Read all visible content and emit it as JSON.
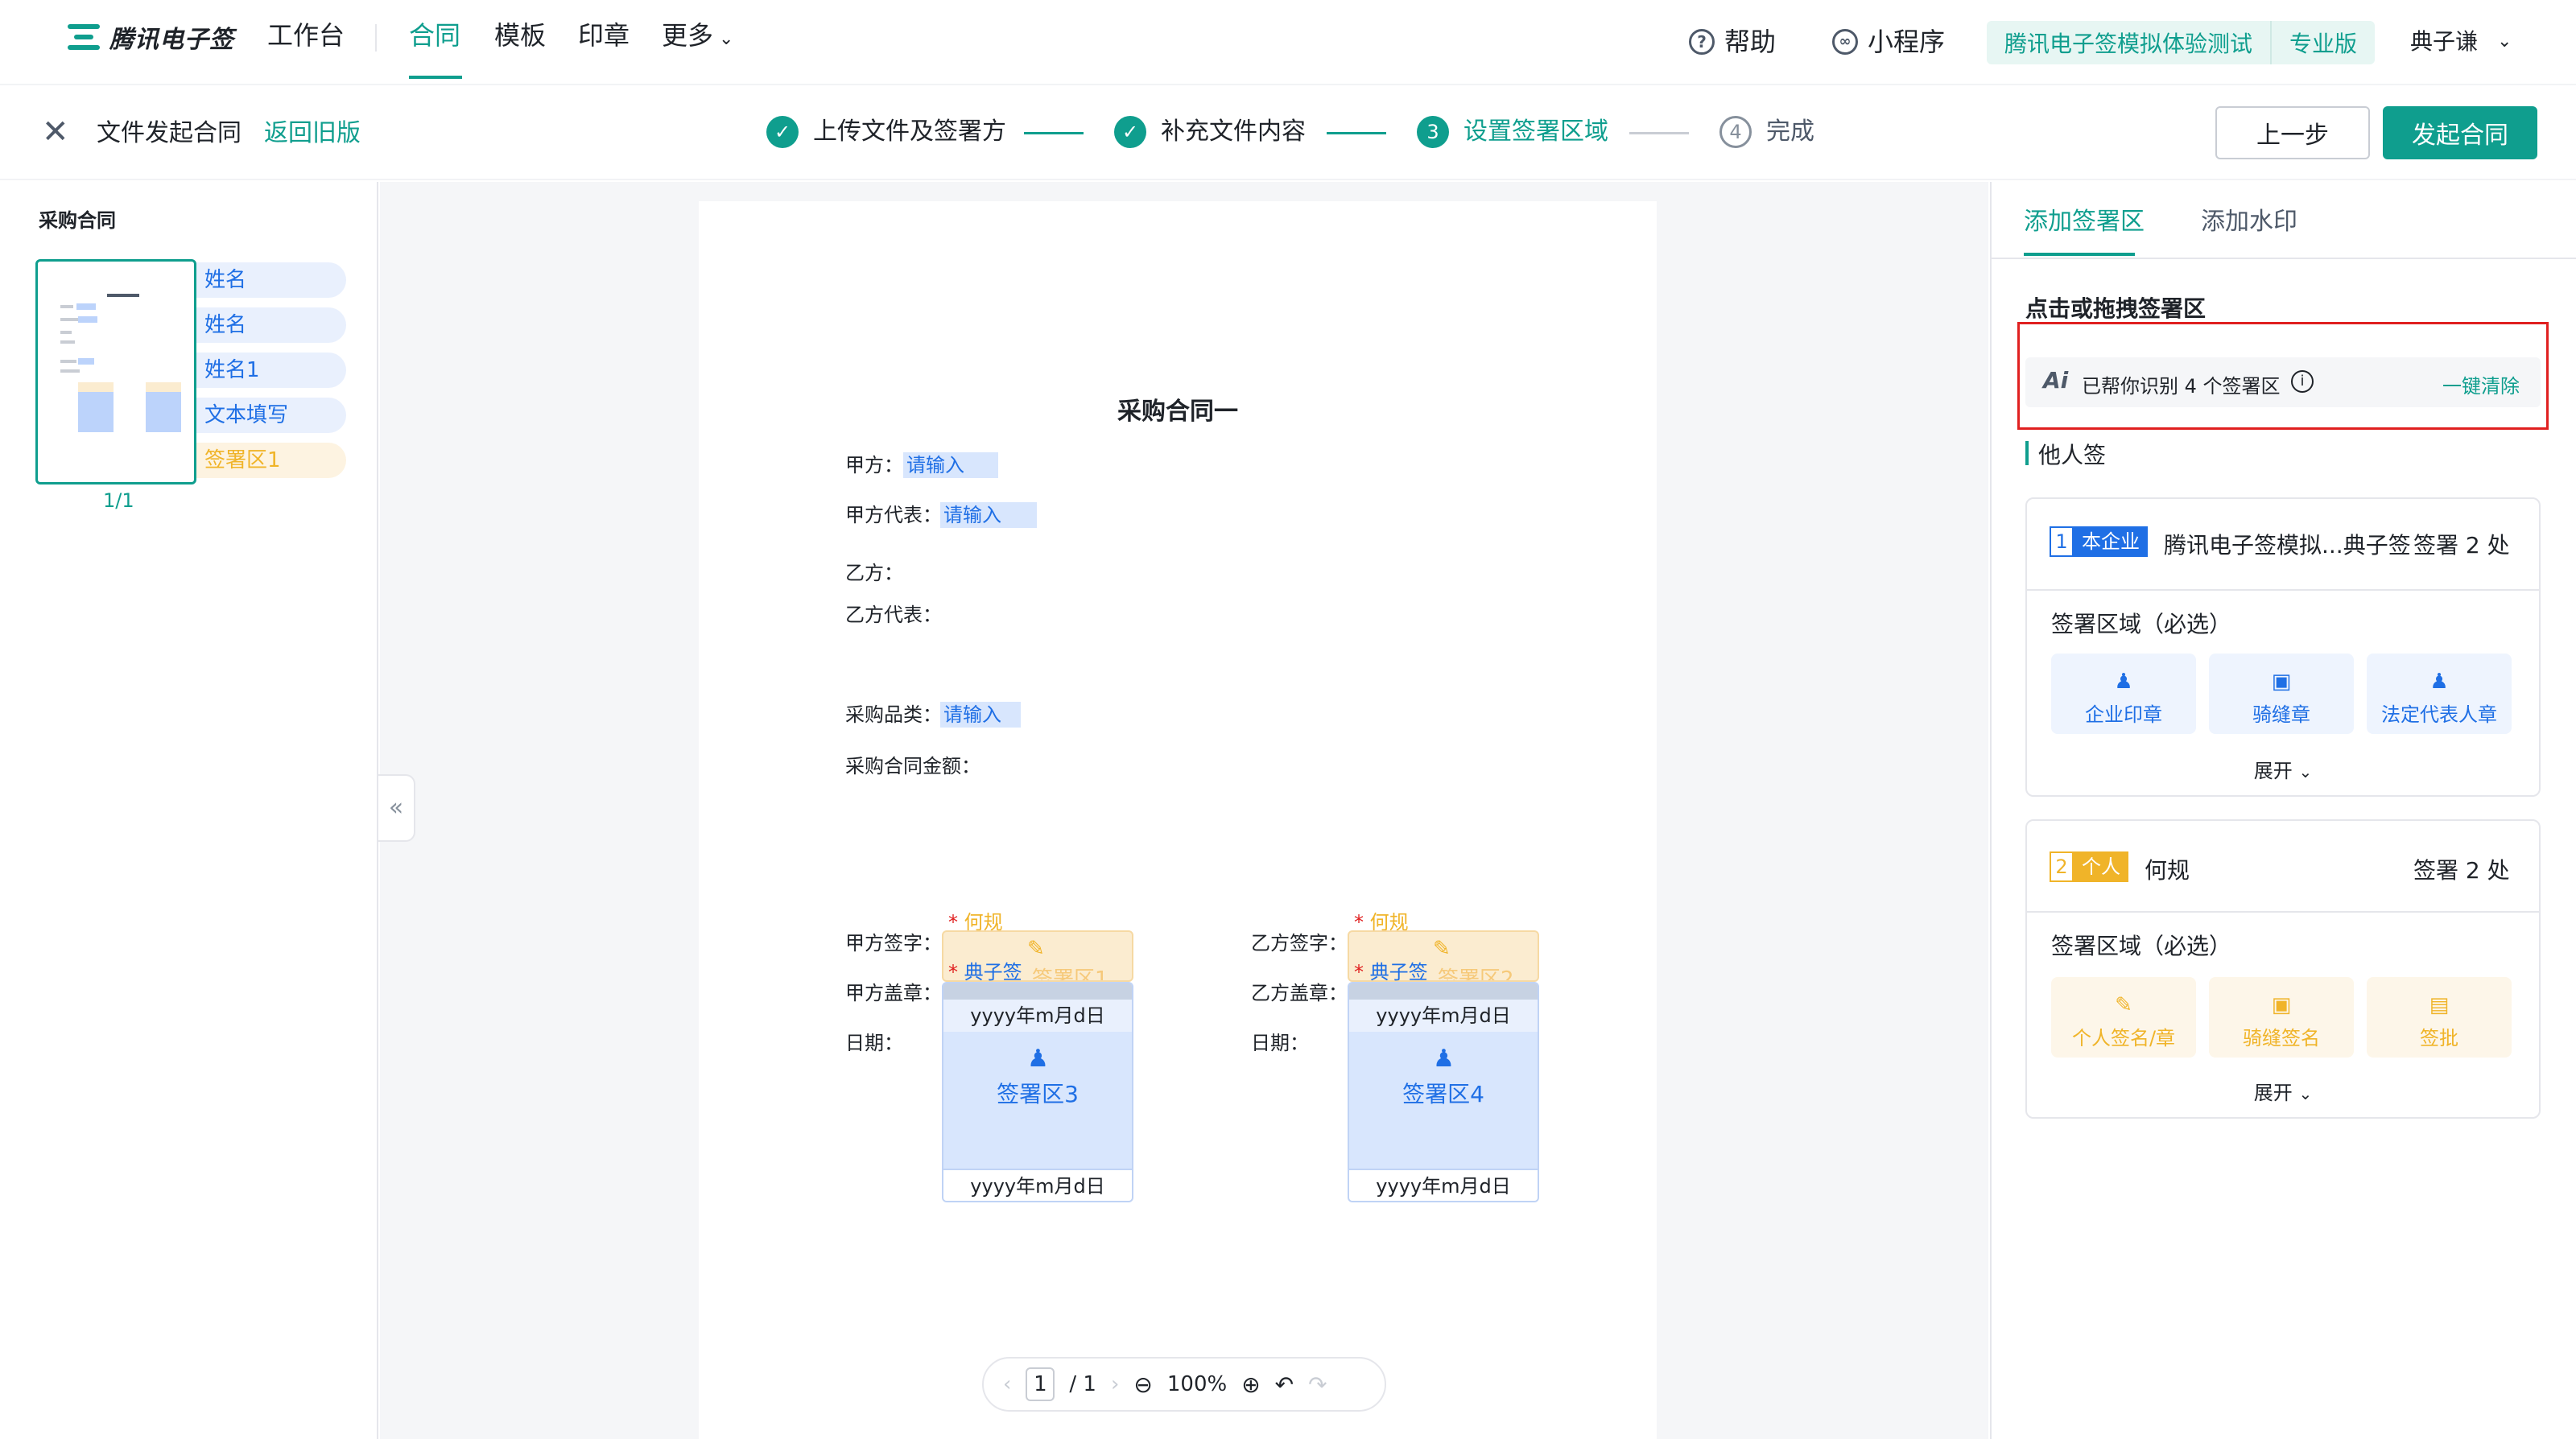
{
  "nav": {
    "logo_text": "腾讯电子签",
    "items": [
      "工作台",
      "合同",
      "模板",
      "印章",
      "更多"
    ],
    "help": "帮助",
    "mini_program": "小程序",
    "org_name": "腾讯电子签模拟体验测试",
    "edition": "专业版",
    "user": "典子谦"
  },
  "stepbar": {
    "close_label": "文件发起合同",
    "back_old": "返回旧版",
    "steps": [
      {
        "label": "上传文件及签署方",
        "state": "done"
      },
      {
        "label": "补充文件内容",
        "state": "done"
      },
      {
        "num": "3",
        "label": "设置签署区域",
        "state": "active"
      },
      {
        "num": "4",
        "label": "完成",
        "state": "todo"
      }
    ],
    "prev_button": "上一步",
    "submit_button": "发起合同"
  },
  "left": {
    "doc_title": "采购合同",
    "fields": [
      "姓名",
      "姓名",
      "姓名1",
      "文本填写",
      "签署区1"
    ],
    "page_count": "1/1"
  },
  "doc": {
    "title": "采购合同一",
    "party_a": "甲方：",
    "party_a_rep": "甲方代表：",
    "party_b": "乙方：",
    "party_b_rep": "乙方代表：",
    "category": "采购品类：",
    "amount": "采购合同金额：",
    "placeholder": "请输入",
    "a_sign": "甲方签字：",
    "a_seal": "甲方盖章：",
    "b_sign": "乙方签字：",
    "b_seal": "乙方盖章：",
    "date": "日期：",
    "signer_personal": "何规",
    "signer_company": "典子签",
    "date_format": "yyyy年m月d日",
    "zone1": "签署区1",
    "zone2": "签署区2",
    "zone3": "签署区3",
    "zone4": "签署区4"
  },
  "pager": {
    "current": "1",
    "total": "/ 1",
    "zoom": "100%"
  },
  "right": {
    "tab_add_zone": "添加签署区",
    "tab_watermark": "添加水印",
    "section_title": "点击或拖拽签署区",
    "ai_text": "已帮你识别 4 个签署区",
    "ai_clear": "一键清除",
    "others_title": "他人签",
    "cards": [
      {
        "index": "1",
        "type": "本企业",
        "name": "腾讯电子签模拟...典子签",
        "count": "签署 2 处",
        "zone_title": "签署区域（必选）",
        "tiles": [
          "企业印章",
          "骑缝章",
          "法定代表人章"
        ],
        "expand": "展开",
        "color": "#1f6fe5"
      },
      {
        "index": "2",
        "type": "个人",
        "name": "何规",
        "count": "签署 2 处",
        "zone_title": "签署区域（必选）",
        "tiles": [
          "个人签名/章",
          "骑缝签名",
          "签批"
        ],
        "expand": "展开",
        "color": "#f0b429"
      }
    ]
  },
  "colors": {
    "brand": "#0f9e8e",
    "company_blue": "#1f6fe5",
    "personal_yellow": "#f0b429",
    "highlight_red": "#e02020"
  }
}
